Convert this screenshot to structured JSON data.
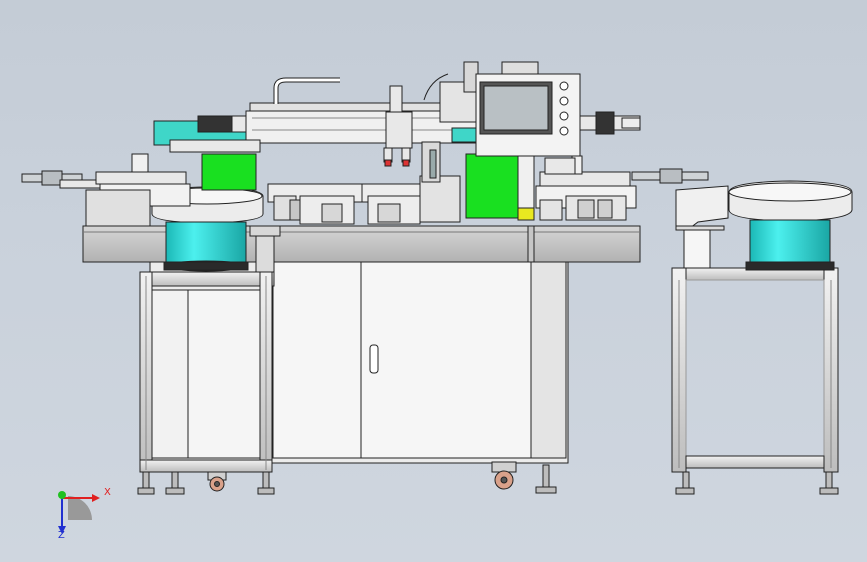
{
  "viewport": {
    "background_top": "#c4ccd6",
    "background_bottom": "#cfd6df"
  },
  "colors": {
    "green_panel": "#19e020",
    "cyan_bowl": "#32e0de",
    "frame": "#d8d8d8",
    "outline": "#222222",
    "screen": "#b9c0c4"
  },
  "triad": {
    "x_label": "X",
    "y_label": "Y",
    "z_label": "Z",
    "x_color": "#e02020",
    "y_color": "#20c020",
    "z_color": "#2030d0"
  }
}
